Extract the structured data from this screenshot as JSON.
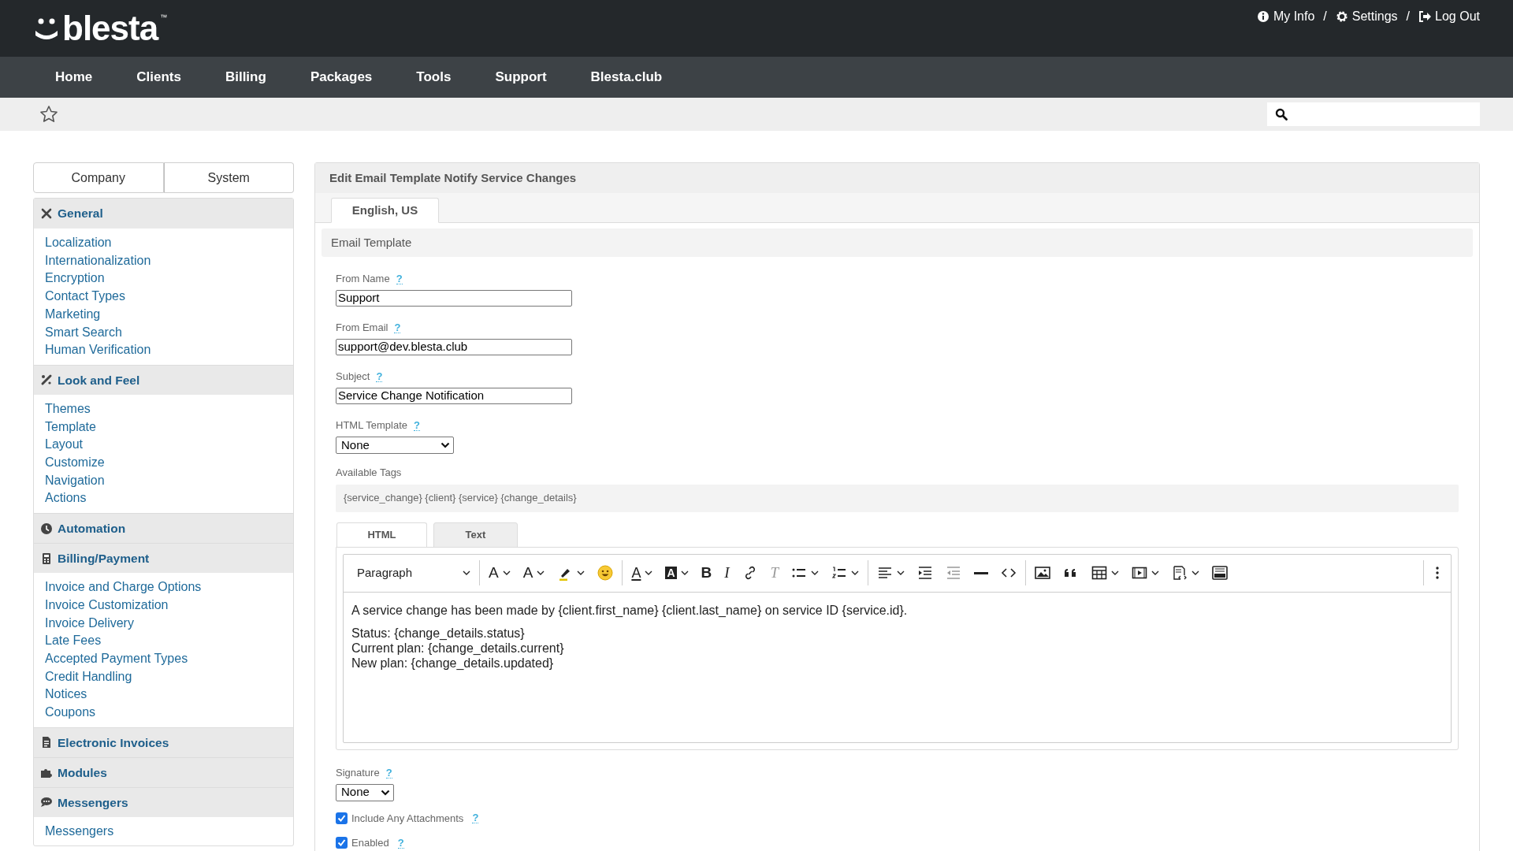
{
  "brand": {
    "logo": "blesta",
    "trademark": "™"
  },
  "user_menu": [
    {
      "label": "My Info"
    },
    {
      "label": "Settings"
    },
    {
      "label": "Log Out"
    }
  ],
  "user_menu_separator": "/",
  "nav": [
    "Home",
    "Clients",
    "Billing",
    "Packages",
    "Tools",
    "Support",
    "Blesta.club"
  ],
  "sidebar": {
    "tabs": [
      "Company",
      "System"
    ],
    "sections": [
      {
        "title": "General",
        "items": [
          "Localization",
          "Internationalization",
          "Encryption",
          "Contact Types",
          "Marketing",
          "Smart Search",
          "Human Verification"
        ]
      },
      {
        "title": "Look and Feel",
        "items": [
          "Themes",
          "Template",
          "Layout",
          "Customize",
          "Navigation",
          "Actions"
        ]
      },
      {
        "title": "Automation"
      },
      {
        "title": "Billing/Payment",
        "items": [
          "Invoice and Charge Options",
          "Invoice Customization",
          "Invoice Delivery",
          "Late Fees",
          "Accepted Payment Types",
          "Credit Handling",
          "Notices",
          "Coupons"
        ]
      },
      {
        "title": "Electronic Invoices"
      },
      {
        "title": "Modules"
      },
      {
        "title": "Messengers",
        "items": [
          "Messengers"
        ]
      }
    ]
  },
  "main": {
    "title": "Edit Email Template Notify Service Changes",
    "language_tabs": [
      {
        "label": "English, US",
        "selected": true
      }
    ],
    "section_title": "Email Template",
    "fields": [
      {
        "kind": "text",
        "label": "From Name",
        "help": "?",
        "value": "Support"
      },
      {
        "kind": "text",
        "label": "From Email",
        "help": "?",
        "value": "support@dev.blesta.club"
      },
      {
        "kind": "text",
        "label": "Subject",
        "help": "?",
        "value": "Service Change Notification"
      },
      {
        "kind": "select",
        "label": "HTML Template",
        "help": "?",
        "value": "None"
      }
    ],
    "available_tags": {
      "label": "Available Tags",
      "value": "{service_change} {client} {service} {change_details}"
    },
    "editor": {
      "tabs": [
        {
          "label": "HTML",
          "selected": true
        },
        {
          "label": "Text",
          "selected": false
        }
      ],
      "toolbar": [
        [
          {
            "kind": "select",
            "label": "Paragraph"
          }
        ],
        [
          {
            "kind": "fontsize",
            "label": "A",
            "caret": true
          },
          {
            "kind": "lineheight",
            "label": "A",
            "caret": true
          },
          {
            "kind": "highlight",
            "caret": true
          },
          {
            "kind": "emoji",
            "caret": false
          }
        ],
        [
          {
            "kind": "textcolor",
            "label": "A",
            "caret": true
          },
          {
            "kind": "bgcolor",
            "label": "A",
            "caret": true
          },
          {
            "kind": "bold",
            "label": "B",
            "caret": false
          },
          {
            "kind": "italic",
            "label": "I",
            "caret": false
          },
          {
            "kind": "link",
            "caret": false
          },
          {
            "kind": "clearformat",
            "label": "T",
            "caret": false
          },
          {
            "kind": "bullist",
            "caret": true
          },
          {
            "kind": "numlist",
            "caret": true
          }
        ],
        [
          {
            "kind": "align",
            "caret": true
          },
          {
            "kind": "indent",
            "caret": false
          },
          {
            "kind": "outdent",
            "caret": false
          },
          {
            "kind": "hr",
            "caret": false
          },
          {
            "kind": "code",
            "caret": false
          }
        ],
        [
          {
            "kind": "image",
            "caret": false
          },
          {
            "kind": "quote",
            "caret": false
          },
          {
            "kind": "table",
            "caret": true
          },
          {
            "kind": "media",
            "caret": true
          },
          {
            "kind": "template",
            "caret": true
          },
          {
            "kind": "source",
            "caret": false
          }
        ]
      ],
      "paragraphs": [
        [
          "A service change has been made by {client.first_name} {client.last_name} on service ID {service.id}."
        ],
        [
          "Status: {change_details.status}",
          "Current plan: {change_details.current}",
          "New plan: {change_details.updated}"
        ]
      ]
    },
    "signature": {
      "label": "Signature",
      "help": "?",
      "value": "None"
    },
    "checkboxes": [
      {
        "label": "Include Any Attachments",
        "help": "?",
        "checked": true
      },
      {
        "label": "Enabled",
        "help": "?",
        "checked": true
      }
    ]
  }
}
